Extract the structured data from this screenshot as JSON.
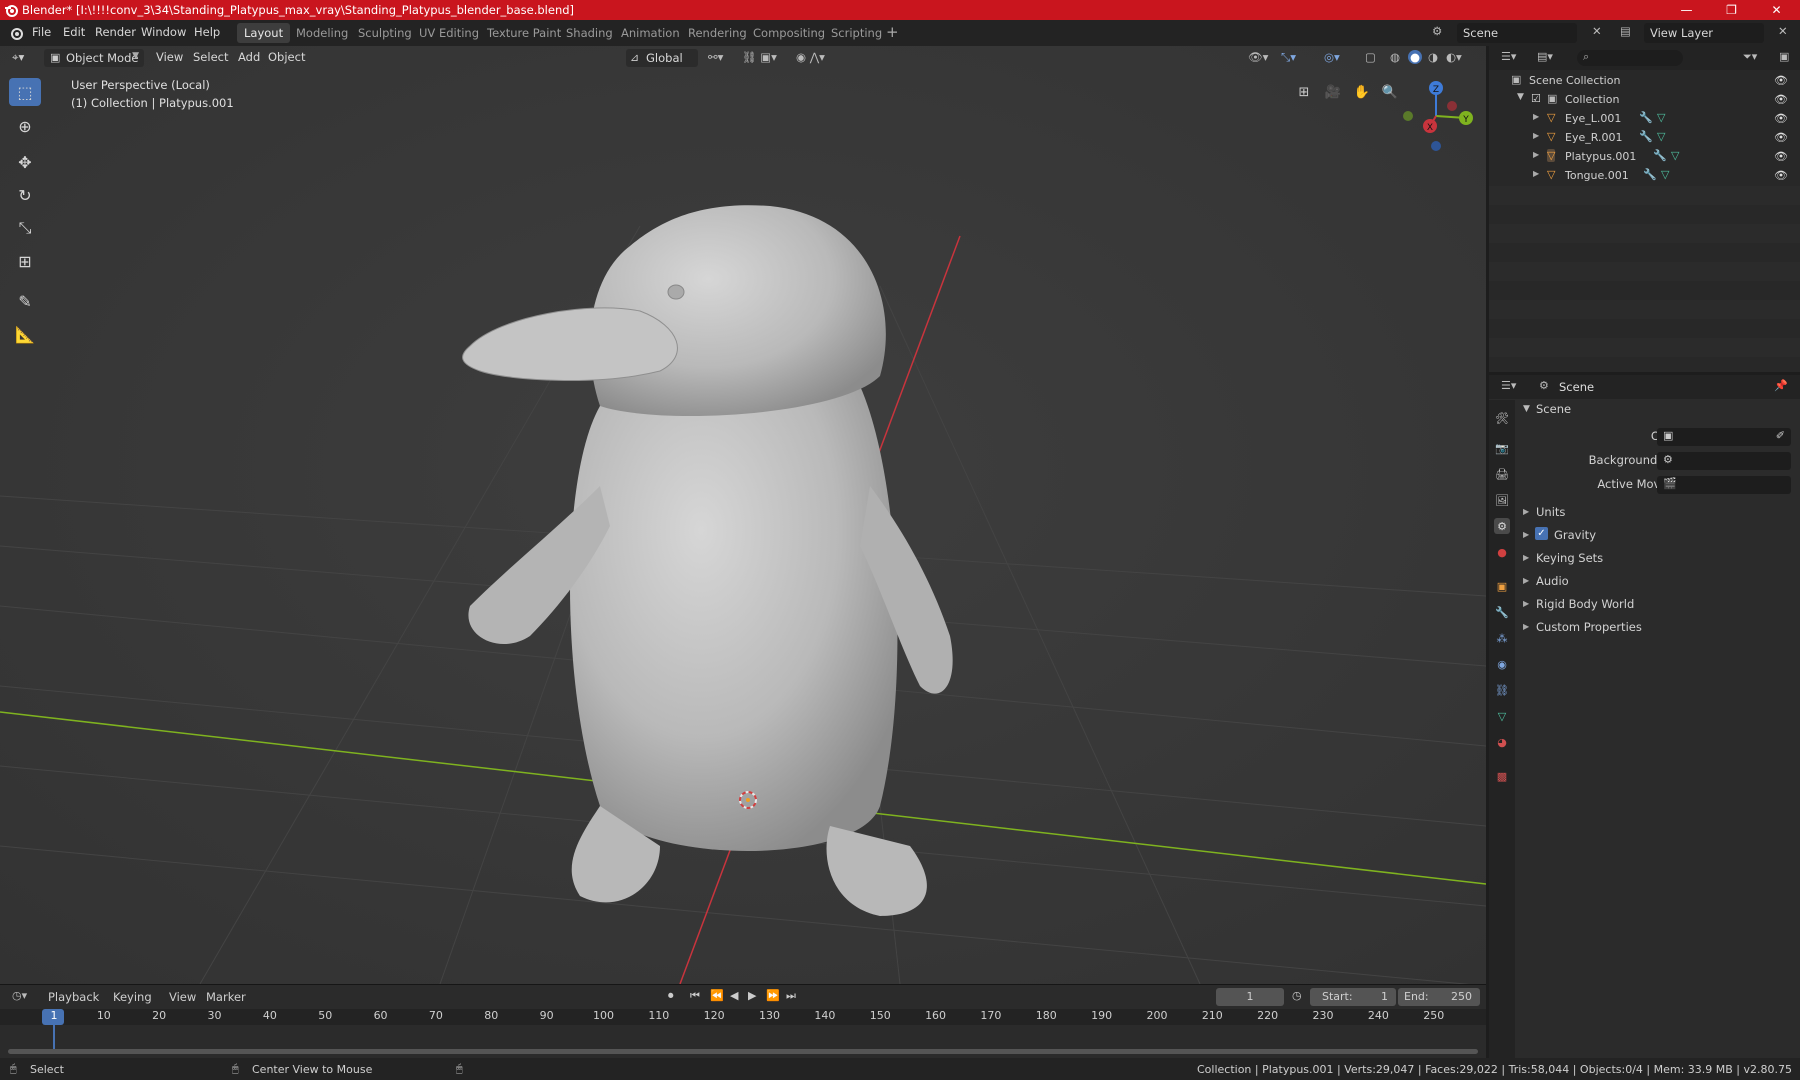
{
  "title_bar": {
    "title": "Blender* [I:\\!!!!conv_3\\34\\Standing_Platypus_max_vray\\Standing_Platypus_blender_base.blend]",
    "minimize": "—",
    "maximize": "❐",
    "close": "✕"
  },
  "menu": {
    "items": [
      "File",
      "Edit",
      "Render",
      "Window",
      "Help"
    ],
    "workspaces": [
      "Layout",
      "Modeling",
      "Sculpting",
      "UV Editing",
      "Texture Paint",
      "Shading",
      "Animation",
      "Rendering",
      "Compositing",
      "Scripting"
    ],
    "active_workspace": "Layout",
    "add_tab": "+",
    "scene": "Scene",
    "view_layer": "View Layer"
  },
  "viewport_header": {
    "mode": "Object Mode",
    "menus": [
      "View",
      "Select",
      "Add",
      "Object"
    ],
    "orientation": "Global"
  },
  "viewport": {
    "perspective_label": "User Perspective (Local)",
    "collection_label": "(1) Collection | Platypus.001",
    "gizmo": {
      "z": "Z",
      "y": "Y",
      "x": "X"
    }
  },
  "outliner": {
    "root": "Scene Collection",
    "collection": "Collection",
    "objects": [
      "Eye_L.001",
      "Eye_R.001",
      "Platypus.001",
      "Tongue.001"
    ]
  },
  "properties": {
    "header": "Scene",
    "panel": "Scene",
    "fields": {
      "camera": "Camera",
      "background_scene": "Background Scene",
      "active_movie_clip": "Active Movie Clip"
    },
    "sections": [
      "Units",
      "Gravity",
      "Keying Sets",
      "Audio",
      "Rigid Body World",
      "Custom Properties"
    ],
    "gravity_checked": true
  },
  "timeline": {
    "menus": [
      "Playback",
      "Keying",
      "View",
      "Marker"
    ],
    "current_frame": "1",
    "start_label": "Start:",
    "start": "1",
    "end_label": "End:",
    "end": "250",
    "ticks": [
      "1",
      "10",
      "20",
      "30",
      "40",
      "50",
      "60",
      "70",
      "80",
      "90",
      "100",
      "110",
      "120",
      "130",
      "140",
      "150",
      "160",
      "170",
      "180",
      "190",
      "200",
      "210",
      "220",
      "230",
      "240",
      "250"
    ]
  },
  "status_bar": {
    "select": "Select",
    "center_view": "Center View to Mouse",
    "stats": "Collection | Platypus.001 | Verts:29,047 | Faces:29,022 | Tris:58,044 | Objects:0/4 | Mem: 33.9 MB | v2.80.75"
  },
  "colors": {
    "title_bar": "#c9151e",
    "accent_blue": "#4772b3",
    "viewport_bg": "#3a3a3a",
    "axis_x": "#c8343d",
    "axis_y": "#7fb31f",
    "axis_z": "#3e7bd8"
  }
}
